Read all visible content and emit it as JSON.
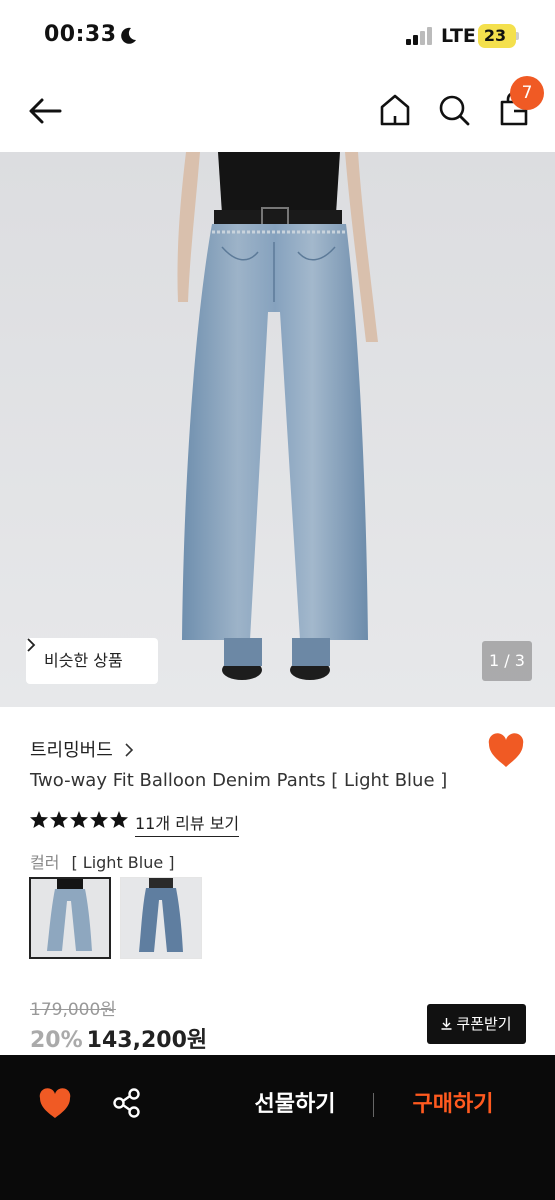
{
  "status_bar": {
    "time": "00:33",
    "network": "LTE",
    "battery": "23"
  },
  "nav": {
    "cart_count": "7"
  },
  "gallery": {
    "similar_label": "비슷한 상품",
    "counter": "1 / 3"
  },
  "product": {
    "brand": "트리밍버드",
    "name": "Two-way Fit Balloon Denim Pants [ Light Blue ]",
    "rating_stars": 5,
    "review_link": "11개 리뷰 보기",
    "color_label": "컬러",
    "color_value": "[ Light Blue ]",
    "original_price": "179,000원",
    "discount": "20%",
    "sale_price": "143,200원",
    "coupon_label": "쿠폰받기"
  },
  "bottom_bar": {
    "gift_label": "선물하기",
    "buy_label": "구매하기"
  },
  "colors": {
    "accent": "#f05a24",
    "buy": "#ff5a1f",
    "heart": "#f05a24",
    "bottom_bg": "#0a0a0a",
    "battery": "#f4e04d"
  }
}
